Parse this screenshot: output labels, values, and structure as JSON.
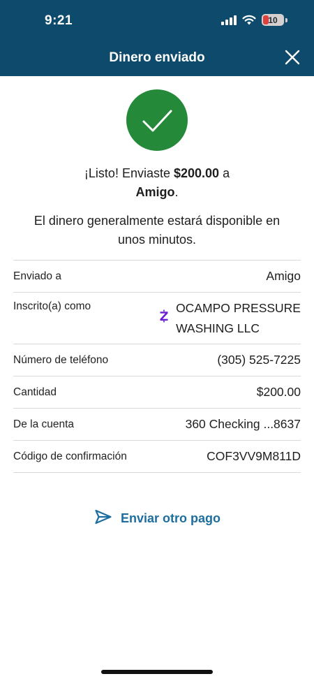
{
  "status_bar": {
    "time": "9:21",
    "battery": "10"
  },
  "header": {
    "title": "Dinero enviado"
  },
  "confirmation": {
    "prefix": "¡Listo! Enviaste ",
    "amount": "$200.00",
    "middle": " a",
    "recipient": "Amigo",
    "suffix": ".",
    "availability": "El dinero generalmente estará disponible en unos minutos."
  },
  "details": {
    "sent_to": {
      "label": "Enviado a",
      "value": "Amigo"
    },
    "enrolled_as": {
      "label": "Inscrito(a) como",
      "value_line1": "OCAMPO PRESSURE",
      "value_line2": "WASHING LLC"
    },
    "phone": {
      "label": "Número de teléfono",
      "value": "(305) 525-7225"
    },
    "amount": {
      "label": "Cantidad",
      "value": "$200.00"
    },
    "from_account": {
      "label": "De la cuenta",
      "value": "360 Checking ...8637"
    },
    "confirmation_code": {
      "label": "Código de confirmación",
      "value": "COF3VV9M811D"
    }
  },
  "actions": {
    "send_again": "Enviar otro pago"
  },
  "icons": {
    "success": "checkmark-circle-icon",
    "close": "close-icon",
    "enrolled_badge": "zelle-icon",
    "send": "send-icon"
  },
  "colors": {
    "header_bg": "#0d4a6b",
    "success_green": "#248a3a",
    "link_blue": "#1d6e9e",
    "zelle_purple": "#6d1ed4"
  }
}
